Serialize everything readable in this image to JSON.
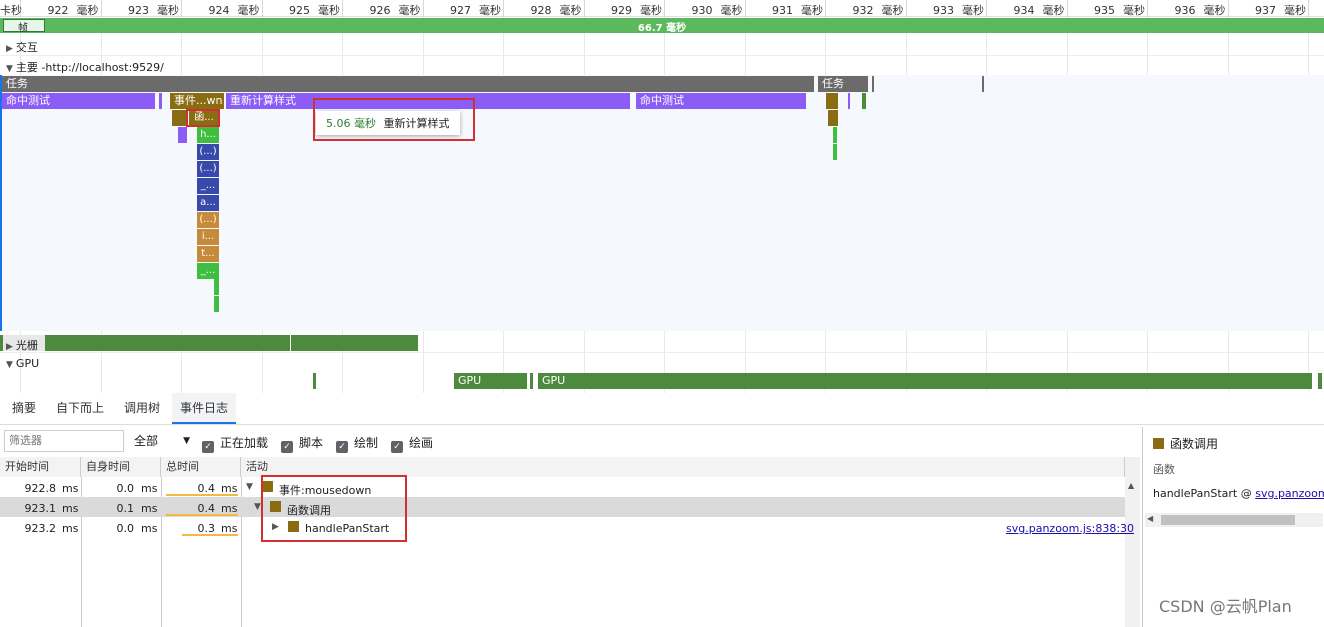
{
  "ruler": {
    "ticks": [
      {
        "num": "卡秒",
        "unit": ""
      },
      {
        "num": "922",
        "unit": "毫秒"
      },
      {
        "num": "923",
        "unit": "毫秒"
      },
      {
        "num": "924",
        "unit": "毫秒"
      },
      {
        "num": "925",
        "unit": "毫秒"
      },
      {
        "num": "926",
        "unit": "毫秒"
      },
      {
        "num": "927",
        "unit": "毫秒"
      },
      {
        "num": "928",
        "unit": "毫秒"
      },
      {
        "num": "929",
        "unit": "毫秒"
      },
      {
        "num": "930",
        "unit": "毫秒"
      },
      {
        "num": "931",
        "unit": "毫秒"
      },
      {
        "num": "932",
        "unit": "毫秒"
      },
      {
        "num": "933",
        "unit": "毫秒"
      },
      {
        "num": "934",
        "unit": "毫秒"
      },
      {
        "num": "935",
        "unit": "毫秒"
      },
      {
        "num": "936",
        "unit": "毫秒"
      },
      {
        "num": "937",
        "unit": "毫秒"
      }
    ]
  },
  "tracks": {
    "frames_label": "帧",
    "frame_duration": "66.7 毫秒",
    "interactions_label": "交互",
    "main_label": "主要 -http://localhost:9529/",
    "raster_label": "光栅",
    "gpu_label": "GPU"
  },
  "flame": {
    "task1": "任务",
    "task2": "任务",
    "hit_test_1": "命中测试",
    "event_bar": "事件...wn",
    "recalc_style": "重新计算样式",
    "hit_test_2": "命中测试",
    "func_call": "函...",
    "stack_labels": [
      "h...",
      "(...)",
      "(...)",
      "_...",
      "a...",
      "(...)",
      "i...",
      "t...",
      "_..."
    ],
    "gpu_bar_1": "GPU",
    "gpu_bar_2": "GPU"
  },
  "tooltip": {
    "time": "5.06 毫秒",
    "name": "重新计算样式"
  },
  "tabs": [
    "摘要",
    "自下而上",
    "调用树",
    "事件日志"
  ],
  "active_tab": "事件日志",
  "filter": {
    "placeholder": "筛选器",
    "select_value": "全部",
    "checkboxes": [
      "正在加载",
      "脚本",
      "绘制",
      "绘画"
    ]
  },
  "table": {
    "headers": [
      "开始时间",
      "自身时间",
      "总时间",
      "活动"
    ],
    "rows": [
      {
        "start": "922.8",
        "start_unit": "ms",
        "self": "0.0",
        "self_unit": "ms",
        "total": "0.4",
        "total_unit": "ms",
        "activity": "事件:mousedown",
        "source": ""
      },
      {
        "start": "923.1",
        "start_unit": "ms",
        "self": "0.1",
        "self_unit": "ms",
        "total": "0.4",
        "total_unit": "ms",
        "activity": "函数调用",
        "source": ""
      },
      {
        "start": "923.2",
        "start_unit": "ms",
        "self": "0.0",
        "self_unit": "ms",
        "total": "0.3",
        "total_unit": "ms",
        "activity": "handlePanStart",
        "source": "svg.panzoom.js:838:30"
      }
    ]
  },
  "details": {
    "title": "函数调用",
    "label": "函数",
    "function_name": "handlePanStart @",
    "function_link": "svg.panzoom.js"
  },
  "watermark": "CSDN @云帆Plan",
  "colors": {
    "task": "#6b6b6b",
    "hit_test": "#8b5cf6",
    "event": "#8a6d12",
    "green": "#3fbf3f",
    "dark_green": "#4e8a3e",
    "blue": "#3949ab"
  }
}
